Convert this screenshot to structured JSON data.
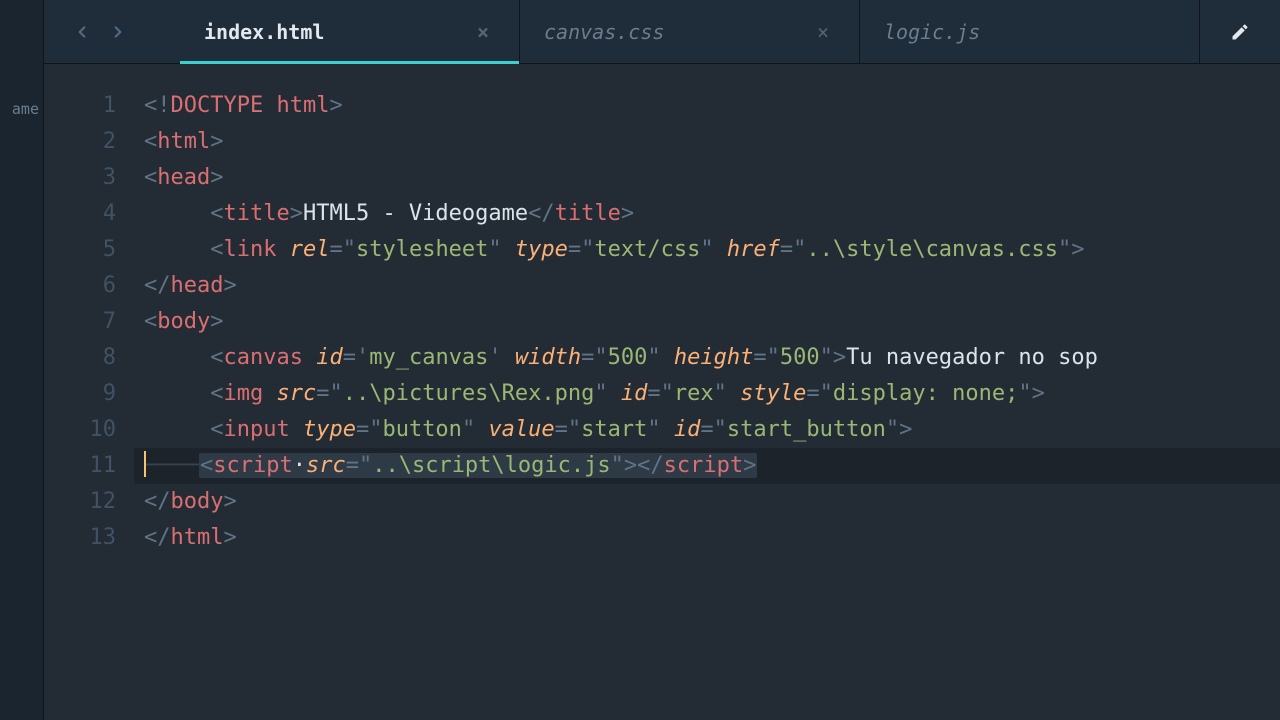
{
  "sidebar": {
    "truncated_label": "ame"
  },
  "tabs": [
    {
      "label": "index.html",
      "active": true,
      "closable": true
    },
    {
      "label": "canvas.css",
      "active": false,
      "closable": true
    },
    {
      "label": "logic.js",
      "active": false,
      "closable": false
    }
  ],
  "close_glyph": "×",
  "editor": {
    "language": "html",
    "current_line": 11,
    "line_numbers": [
      "1",
      "2",
      "3",
      "4",
      "5",
      "6",
      "7",
      "8",
      "9",
      "10",
      "11",
      "12",
      "13"
    ],
    "lines": [
      {
        "indent": 0,
        "tokens": [
          [
            "pun",
            "<"
          ],
          [
            "bang",
            "!"
          ],
          [
            "doctype",
            "DOCTYPE html"
          ],
          [
            "pun",
            ">"
          ]
        ]
      },
      {
        "indent": 0,
        "tokens": [
          [
            "pun",
            "<"
          ],
          [
            "tag",
            "html"
          ],
          [
            "pun",
            ">"
          ]
        ]
      },
      {
        "indent": 0,
        "tokens": [
          [
            "pun",
            "<"
          ],
          [
            "tag",
            "head"
          ],
          [
            "pun",
            ">"
          ]
        ]
      },
      {
        "indent": 1,
        "tokens": [
          [
            "pun",
            "<"
          ],
          [
            "tag",
            "title"
          ],
          [
            "pun",
            ">"
          ],
          [
            "txt",
            "HTML5 - Videogame"
          ],
          [
            "pun",
            "</"
          ],
          [
            "tag",
            "title"
          ],
          [
            "pun",
            ">"
          ]
        ]
      },
      {
        "indent": 1,
        "tokens": [
          [
            "pun",
            "<"
          ],
          [
            "tag",
            "link"
          ],
          [
            "txt",
            " "
          ],
          [
            "attr",
            "rel"
          ],
          [
            "pun",
            "="
          ],
          [
            "pun",
            "\""
          ],
          [
            "str",
            "stylesheet"
          ],
          [
            "pun",
            "\""
          ],
          [
            "txt",
            " "
          ],
          [
            "attr",
            "type"
          ],
          [
            "pun",
            "="
          ],
          [
            "pun",
            "\""
          ],
          [
            "str",
            "text/css"
          ],
          [
            "pun",
            "\""
          ],
          [
            "txt",
            " "
          ],
          [
            "attr",
            "href"
          ],
          [
            "pun",
            "="
          ],
          [
            "pun",
            "\""
          ],
          [
            "str",
            "..\\style\\canvas.css"
          ],
          [
            "pun",
            "\""
          ],
          [
            "pun",
            ">"
          ]
        ]
      },
      {
        "indent": 0,
        "tokens": [
          [
            "pun",
            "</"
          ],
          [
            "tag",
            "head"
          ],
          [
            "pun",
            ">"
          ]
        ]
      },
      {
        "indent": 0,
        "tokens": [
          [
            "pun",
            "<"
          ],
          [
            "tag",
            "body"
          ],
          [
            "pun",
            ">"
          ]
        ]
      },
      {
        "indent": 1,
        "tokens": [
          [
            "pun",
            "<"
          ],
          [
            "tag",
            "canvas"
          ],
          [
            "txt",
            " "
          ],
          [
            "attr",
            "id"
          ],
          [
            "pun",
            "="
          ],
          [
            "pun",
            "'"
          ],
          [
            "str",
            "my_canvas"
          ],
          [
            "pun",
            "'"
          ],
          [
            "txt",
            " "
          ],
          [
            "attr",
            "width"
          ],
          [
            "pun",
            "="
          ],
          [
            "pun",
            "\""
          ],
          [
            "str",
            "500"
          ],
          [
            "pun",
            "\""
          ],
          [
            "txt",
            " "
          ],
          [
            "attr",
            "height"
          ],
          [
            "pun",
            "="
          ],
          [
            "pun",
            "\""
          ],
          [
            "str",
            "500"
          ],
          [
            "pun",
            "\""
          ],
          [
            "pun",
            ">"
          ],
          [
            "txt",
            "Tu navegador no sop"
          ]
        ]
      },
      {
        "indent": 1,
        "tokens": [
          [
            "pun",
            "<"
          ],
          [
            "tag",
            "img"
          ],
          [
            "txt",
            " "
          ],
          [
            "attr",
            "src"
          ],
          [
            "pun",
            "="
          ],
          [
            "pun",
            "\""
          ],
          [
            "str",
            "..\\pictures\\Rex.png"
          ],
          [
            "pun",
            "\""
          ],
          [
            "txt",
            " "
          ],
          [
            "attr",
            "id"
          ],
          [
            "pun",
            "="
          ],
          [
            "pun",
            "\""
          ],
          [
            "str",
            "rex"
          ],
          [
            "pun",
            "\""
          ],
          [
            "txt",
            " "
          ],
          [
            "attr",
            "style"
          ],
          [
            "pun",
            "="
          ],
          [
            "pun",
            "\""
          ],
          [
            "str",
            "display: none;"
          ],
          [
            "pun",
            "\""
          ],
          [
            "pun",
            ">"
          ]
        ]
      },
      {
        "indent": 1,
        "tokens": [
          [
            "pun",
            "<"
          ],
          [
            "tag",
            "input"
          ],
          [
            "txt",
            " "
          ],
          [
            "attr",
            "type"
          ],
          [
            "pun",
            "="
          ],
          [
            "pun",
            "\""
          ],
          [
            "str",
            "button"
          ],
          [
            "pun",
            "\""
          ],
          [
            "txt",
            " "
          ],
          [
            "attr",
            "value"
          ],
          [
            "pun",
            "="
          ],
          [
            "pun",
            "\""
          ],
          [
            "str",
            "start"
          ],
          [
            "pun",
            "\""
          ],
          [
            "txt",
            " "
          ],
          [
            "attr",
            "id"
          ],
          [
            "pun",
            "="
          ],
          [
            "pun",
            "\""
          ],
          [
            "str",
            "start_button"
          ],
          [
            "pun",
            "\""
          ],
          [
            "pun",
            ">"
          ]
        ]
      },
      {
        "indent": 1,
        "current": true,
        "selected_tail": true,
        "tokens": [
          [
            "pun",
            "<"
          ],
          [
            "tag",
            "script"
          ],
          [
            "txt",
            "·"
          ],
          [
            "attr",
            "src"
          ],
          [
            "pun",
            "="
          ],
          [
            "pun",
            "\""
          ],
          [
            "str",
            "..\\script\\logic.js"
          ],
          [
            "pun",
            "\""
          ],
          [
            "pun",
            ">"
          ],
          [
            "pun",
            "</"
          ],
          [
            "tag",
            "script"
          ],
          [
            "pun",
            ">"
          ]
        ]
      },
      {
        "indent": 0,
        "tokens": [
          [
            "pun",
            "</"
          ],
          [
            "tag",
            "body"
          ],
          [
            "pun",
            ">"
          ]
        ]
      },
      {
        "indent": 0,
        "tokens": [
          [
            "pun",
            "</"
          ],
          [
            "tag",
            "html"
          ],
          [
            "pun",
            ">"
          ]
        ]
      }
    ]
  }
}
